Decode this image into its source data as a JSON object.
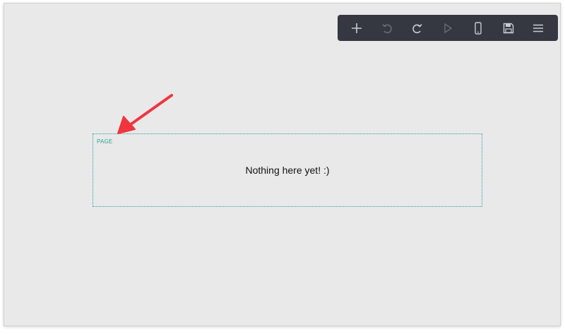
{
  "toolbar": {
    "buttons": [
      {
        "name": "add",
        "icon": "plus-icon",
        "enabled": true
      },
      {
        "name": "undo",
        "icon": "undo-icon",
        "enabled": false
      },
      {
        "name": "redo",
        "icon": "redo-icon",
        "enabled": true
      },
      {
        "name": "play",
        "icon": "play-icon",
        "enabled": false
      },
      {
        "name": "preview",
        "icon": "phone-icon",
        "enabled": true
      },
      {
        "name": "save",
        "icon": "save-icon",
        "enabled": true
      },
      {
        "name": "menu",
        "icon": "hamburger-icon",
        "enabled": true
      }
    ]
  },
  "canvas": {
    "page_label": "PAGE",
    "empty_message": "Nothing here yet! :)"
  },
  "annotation": {
    "arrow_icon": "red-arrow-icon",
    "arrow_color": "#f0353f"
  },
  "colors": {
    "toolbar_bg": "#353841",
    "icon": "#c9cbd1",
    "page_border": "#2aa198",
    "canvas_bg": "#e9e9e9"
  }
}
